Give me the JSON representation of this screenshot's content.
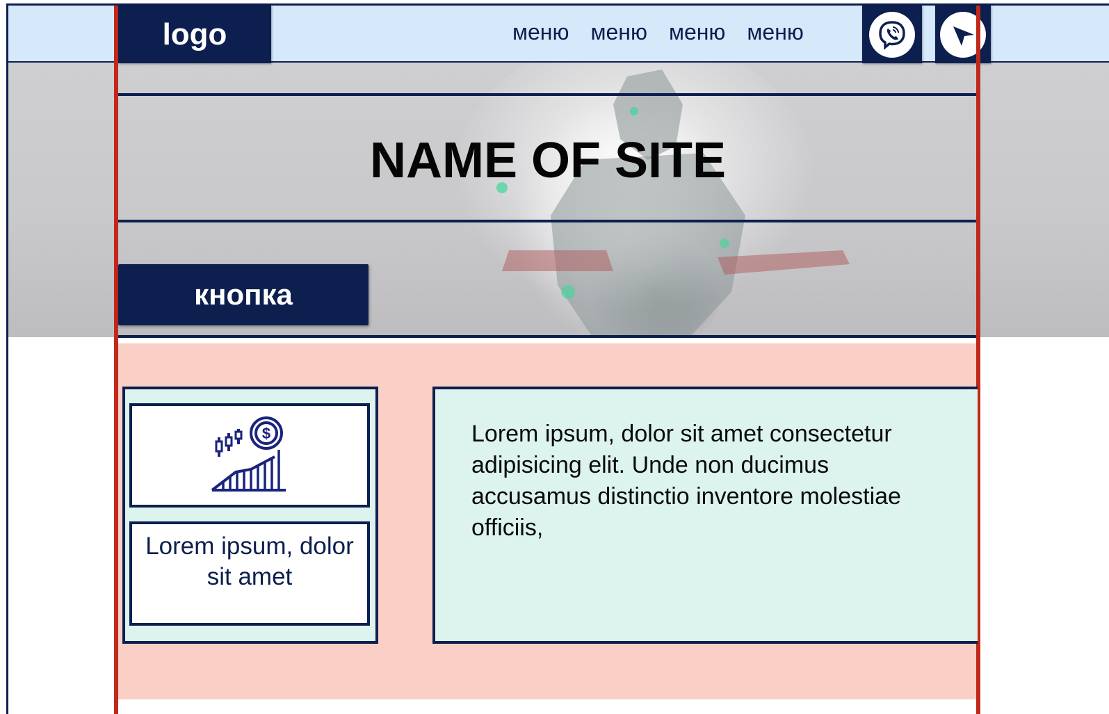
{
  "header": {
    "logo_text": "logo",
    "menu_items": [
      "меню",
      "меню",
      "меню",
      "меню"
    ],
    "icons": [
      "viber-icon",
      "telegram-icon"
    ]
  },
  "hero": {
    "title": "NAME OF SITE",
    "button_label": "кнопка"
  },
  "feature": {
    "icon": "finance-growth-icon",
    "card_caption": "Lorem ipsum, dolor sit amet",
    "body_text": "Lorem ipsum, dolor sit amet consectetur adipisicing elit. Unde non ducimus accusamus distinctio inventore molestiae officiis,"
  },
  "colors": {
    "navy": "#0c1f4e",
    "header_bg": "#d6e9fb",
    "guide_red": "#c0281b",
    "section_pink": "#f9cfc6",
    "card_mint": "#ddf4ee"
  }
}
